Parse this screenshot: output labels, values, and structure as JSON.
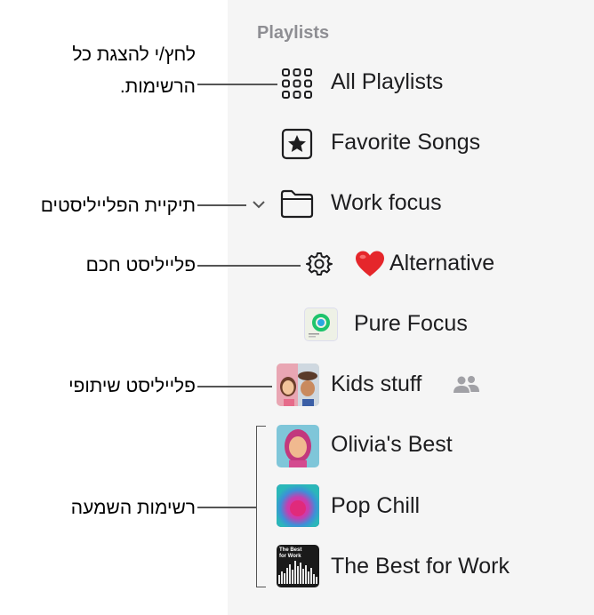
{
  "sidebar": {
    "section_title": "Playlists",
    "items": [
      {
        "label": "All Playlists",
        "icon": "grid-icon"
      },
      {
        "label": "Favorite Songs",
        "icon": "star-icon"
      },
      {
        "label": "Work focus",
        "icon": "folder-icon"
      },
      {
        "label": "Alternative",
        "icon": "heart-emoji-icon",
        "emoji": "❤️"
      },
      {
        "label": "Pure Focus",
        "icon": "pure-focus-artwork"
      },
      {
        "label": "Kids stuff",
        "icon": "kids-stuff-artwork"
      },
      {
        "label": "Olivia's Best",
        "icon": "olivia-artwork"
      },
      {
        "label": "Pop Chill",
        "icon": "pop-chill-artwork"
      },
      {
        "label": "The Best for Work",
        "icon": "best-for-work-artwork"
      }
    ]
  },
  "callouts": {
    "all_playlists_line1": "לחץ/י להצגת כל",
    "all_playlists_line2": "הרשימות.",
    "folder": "תיקיית הפלייליסטים",
    "smart": "פלייליסט חכם",
    "shared": "פלייליסט שיתופי",
    "playlists": "רשימות השמעה"
  },
  "artwork_text": {
    "best_for_work": "The Best for Work"
  },
  "colors": {
    "sidebar_bg": "#f5f5f5",
    "section_title": "#8e8e93",
    "callout_line": "#555555"
  }
}
